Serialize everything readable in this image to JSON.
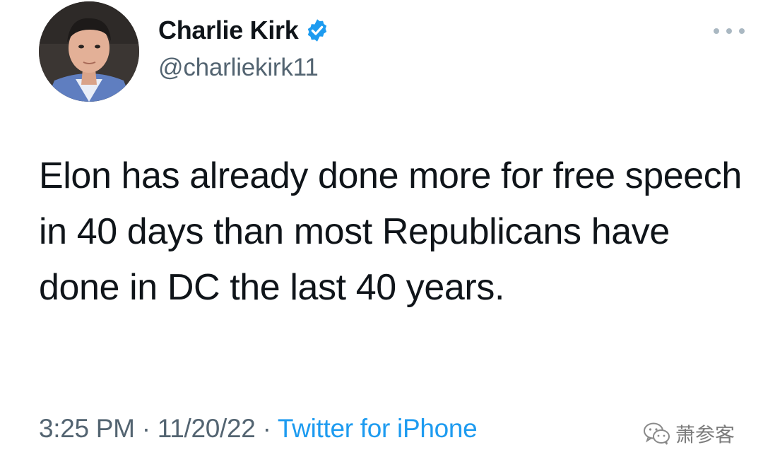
{
  "tweet": {
    "author": {
      "display_name": "Charlie Kirk",
      "handle": "@charliekirk11",
      "verified": true,
      "verified_color": "#1d9bf0"
    },
    "text": "Elon has already done more for free speech in 40 days than most Republicans have done in DC the last 40 years.",
    "time": "3:25 PM",
    "date": "11/20/22",
    "separator": "·",
    "source": "Twitter for iPhone",
    "source_color": "#1d9bf0",
    "more_icon": "more-dots-icon"
  },
  "watermark": {
    "text": "萧参客",
    "icon": "wechat-icon"
  }
}
